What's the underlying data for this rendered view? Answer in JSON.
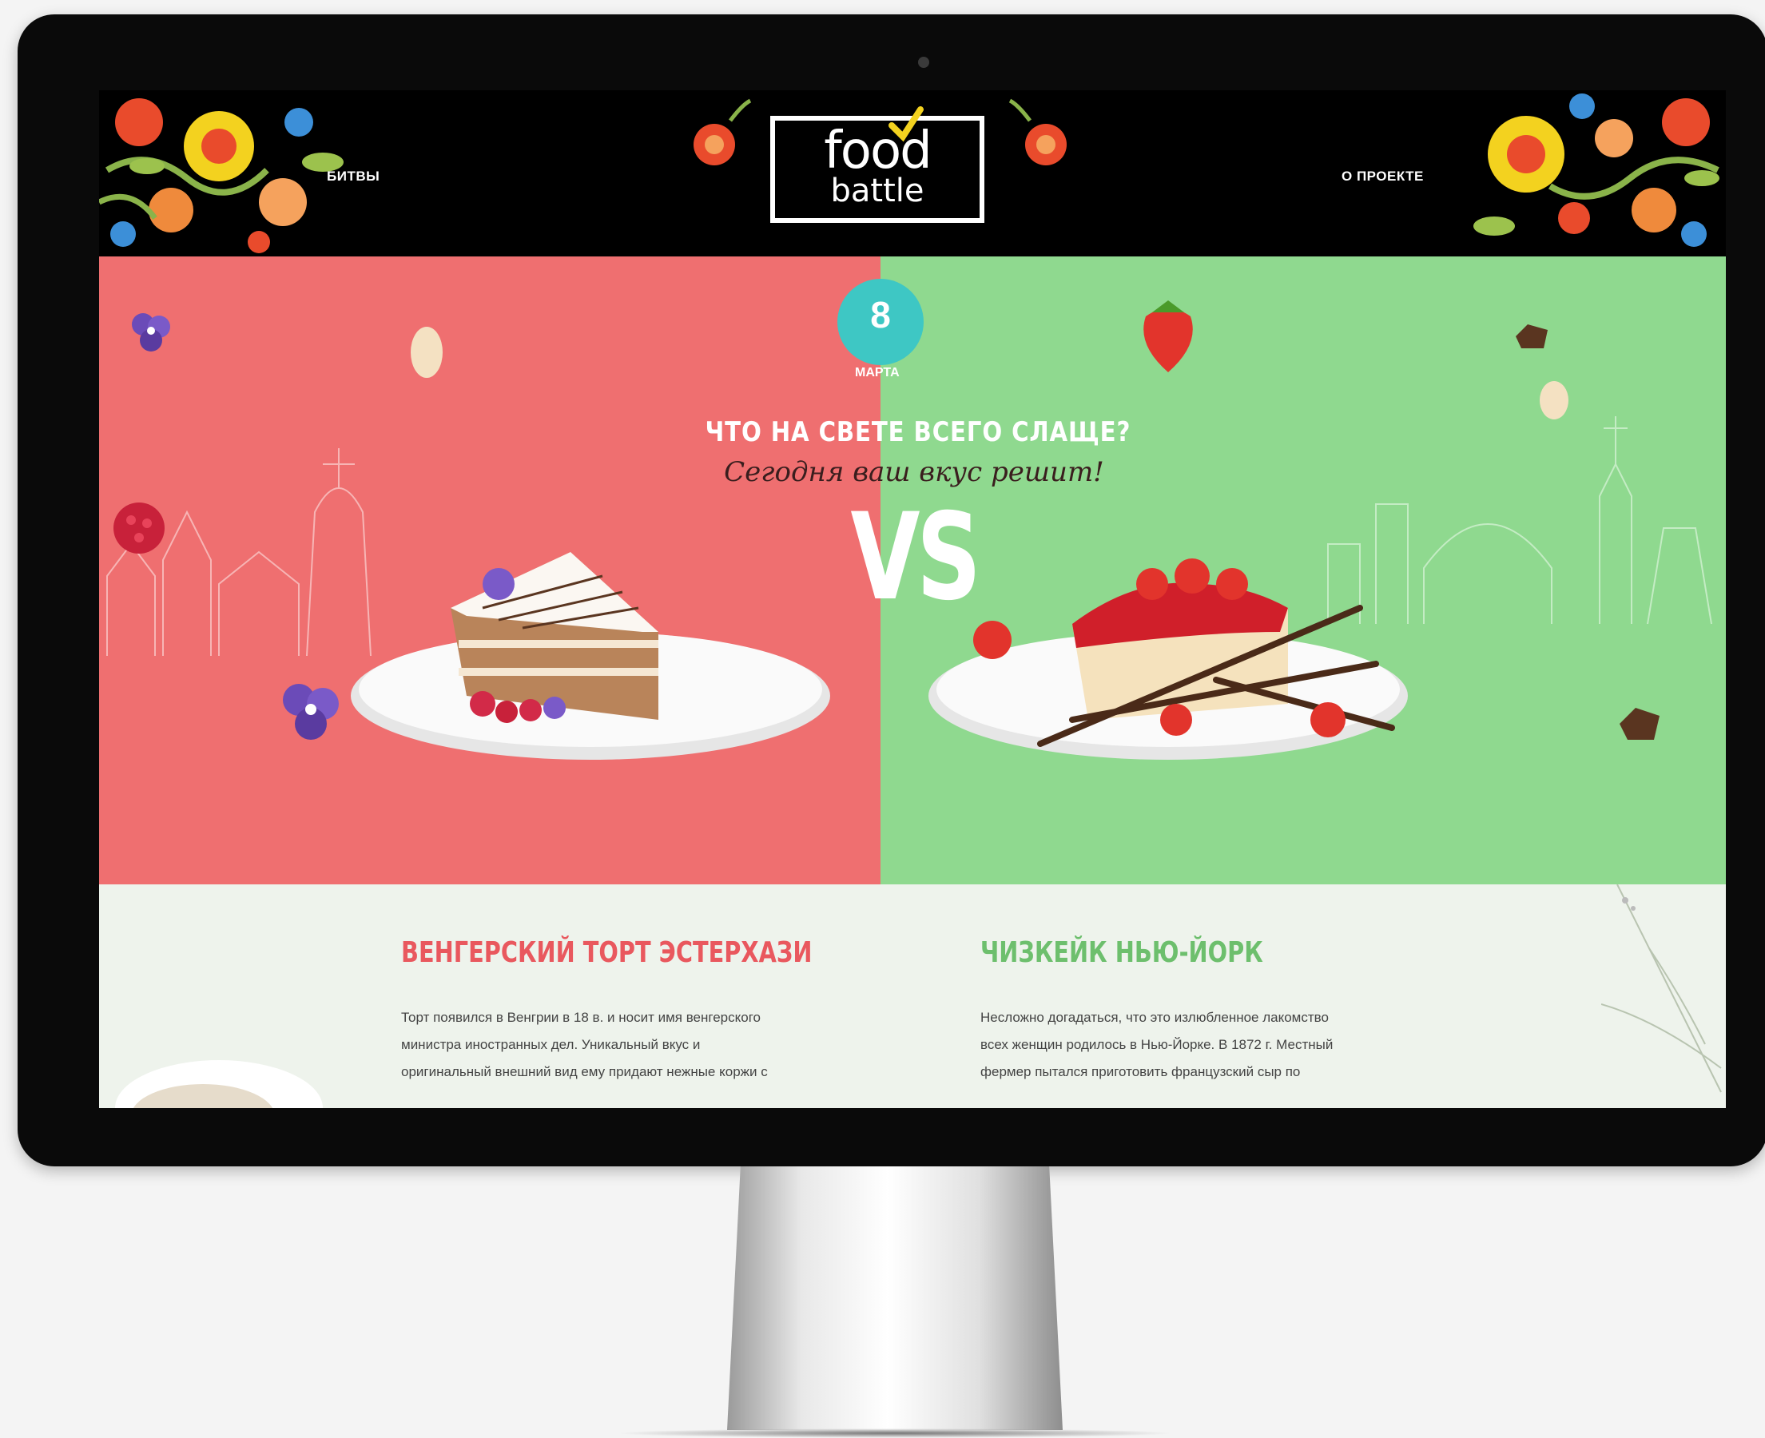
{
  "nav": {
    "left": "БИТВЫ",
    "right": "О ПРОЕКТЕ"
  },
  "logo": {
    "top": "food",
    "bottom": "battle"
  },
  "badge": {
    "number": "8",
    "label": "МАРТА"
  },
  "hero": {
    "headline": "ЧТО НА СВЕТЕ ВСЕГО СЛАЩЕ?",
    "tagline": "Сегодня ваш вкус решит!",
    "vs": "VS",
    "left_color": "#ef6f70",
    "right_color": "#8fd98f"
  },
  "dishes": [
    {
      "title": "ВЕНГЕРСКИЙ ТОРТ ЭСТЕРХАЗИ",
      "text": "Торт появился в Венгрии в 18 в. и носит имя венгерского министра иностранных дел. Уникальный вкус и оригинальный внешний вид ему придают нежные коржи с"
    },
    {
      "title": "ЧИЗКЕЙК НЬЮ-ЙОРК",
      "text": "Несложно догадаться, что это излюбленное лакомство всех женщин родилось в Нью-Йорке. В 1872 г. Местный фермер пытался приготовить французский сыр по"
    }
  ]
}
